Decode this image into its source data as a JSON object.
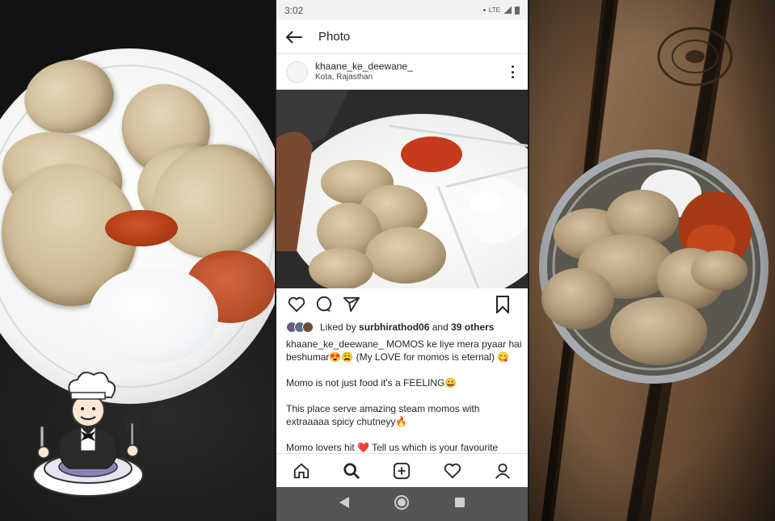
{
  "status_bar": {
    "time": "3:02",
    "network": "LTE"
  },
  "app_bar": {
    "title": "Photo"
  },
  "post": {
    "username": "khaane_ke_deewane_",
    "location": "Kota, Rajasthan",
    "liked_by_prefix": "Liked by",
    "liked_by_user": "surbhirathod06",
    "liked_by_and": "and",
    "liked_by_others": "39 others",
    "caption_user": "khaane_ke_deewane_",
    "caption_line1": "MOMOS ke liye mera pyaar hai beshumar😍😩 (My LOVE for momos is eternal) 😋",
    "caption_line2": "Momo is not just food it's a FEELING😀",
    "caption_line3": "This place serve amazing steam momos with extraaaaa spicy chutneyy🔥",
    "caption_line4": "Momo lovers hit ❤️ Tell us which is your favourite"
  },
  "icons": {
    "back": "back-arrow-icon",
    "more": "more-vertical-icon",
    "like": "heart-icon",
    "comment": "comment-icon",
    "share": "send-icon",
    "save": "bookmark-icon",
    "home": "home-icon",
    "search": "search-icon",
    "add": "add-post-icon",
    "activity": "heart-icon",
    "profile": "profile-icon",
    "android_back": "android-back-icon",
    "android_home": "android-home-icon",
    "android_recents": "android-recents-icon"
  },
  "colors": {
    "text_primary": "#262626",
    "android_nav_bg": "#555555",
    "chutney": "#b03d15"
  }
}
